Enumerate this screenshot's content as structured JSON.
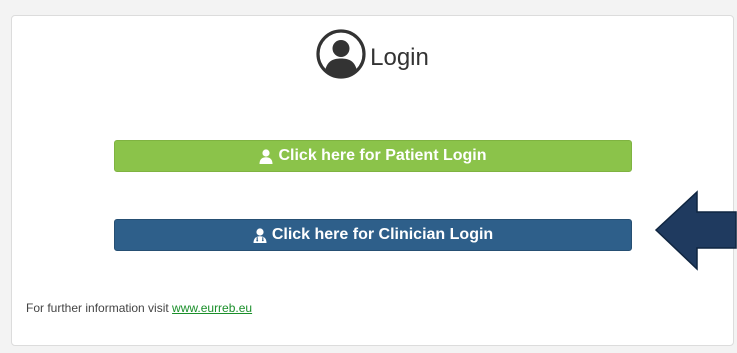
{
  "login": {
    "title": "Login",
    "patient_button": "Click here for Patient Login",
    "clinician_button": "Click here for Clinician Login"
  },
  "footer": {
    "text": "For further information visit ",
    "link_text": "www.eurreb.eu"
  },
  "colors": {
    "patient_button": "#8bc34a",
    "clinician_button": "#2e5f8a",
    "arrow": "#1f3a5f",
    "link": "#1a8f2a"
  },
  "icons": {
    "header": "user-circle-icon",
    "patient": "user-icon",
    "clinician": "doctor-icon",
    "pointer": "left-arrow-icon"
  }
}
